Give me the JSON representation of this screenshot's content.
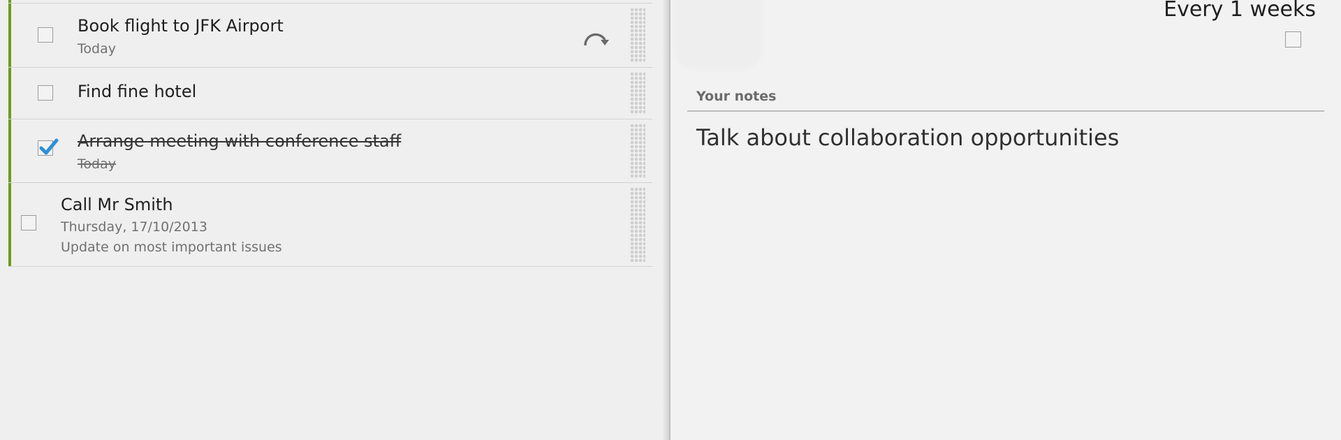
{
  "tasks": [
    {
      "title": "Book flight to JFK Airport",
      "subtitle": "Today",
      "completed": false,
      "repeating": true,
      "icon": "repeat-icon"
    },
    {
      "title": "Find fine hotel",
      "completed": false,
      "repeating": false
    },
    {
      "title": "Arrange meeting with conference staff",
      "subtitle": "Today",
      "completed": true,
      "repeating": false
    },
    {
      "title": "Call Mr Smith",
      "subtitle": "Thursday, 17/10/2013",
      "note": "Update on most important issues",
      "completed": false,
      "repeating": false
    }
  ],
  "detail": {
    "repeat_text": "Every 1 weeks",
    "repeat_checked": false,
    "notes_label": "Your notes",
    "notes_text": "Talk about collaboration opportunities"
  },
  "colors": {
    "accent": "#6f9b1c",
    "checkmark": "#2f8fd8",
    "divider": "#d2d2d2"
  }
}
